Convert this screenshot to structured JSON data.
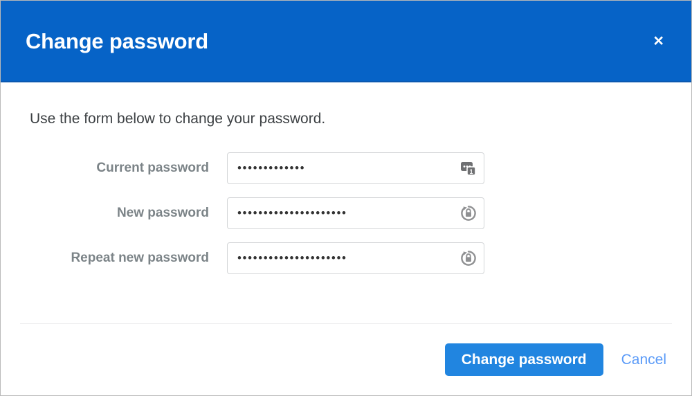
{
  "dialog": {
    "title": "Change password",
    "close_label": "×",
    "intro": "Use the form below to change your password.",
    "accent_color": "#0663c7",
    "primary_button_color": "#2185e0",
    "link_color": "#5b9bf8",
    "label_color": "#7b8387"
  },
  "form": {
    "fields": [
      {
        "label": "Current password",
        "value": "•••••••••••••",
        "placeholder": "",
        "icon": "saved-credentials-icon",
        "icon_badge": "1"
      },
      {
        "label": "New password",
        "value": "•••••••••••••••••••••",
        "placeholder": "",
        "icon": "generate-password-icon",
        "icon_badge": ""
      },
      {
        "label": "Repeat new password",
        "value": "•••••••••••••••••••••",
        "placeholder": "",
        "icon": "generate-password-icon",
        "icon_badge": ""
      }
    ]
  },
  "footer": {
    "submit_label": "Change password",
    "cancel_label": "Cancel"
  }
}
